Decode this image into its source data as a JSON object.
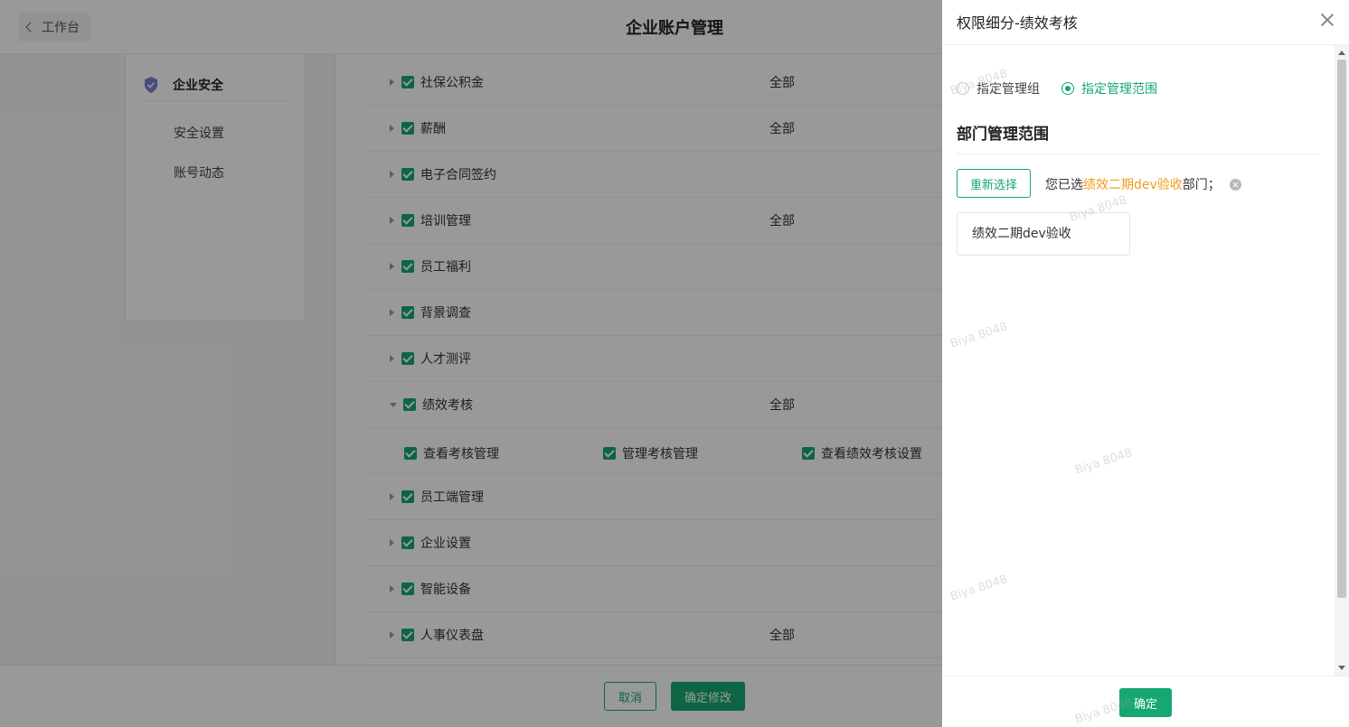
{
  "header": {
    "back_label": "工作台",
    "title": "企业账户管理"
  },
  "sidebar": {
    "section_label": "企业安全",
    "items": [
      {
        "label": "安全设置"
      },
      {
        "label": "账号动态"
      }
    ]
  },
  "permissions": {
    "rows": [
      {
        "label": "社保公积金",
        "scope": "全部"
      },
      {
        "label": "薪酬",
        "scope": "全部"
      },
      {
        "label": "电子合同签约",
        "scope": ""
      },
      {
        "label": "培训管理",
        "scope": "全部"
      },
      {
        "label": "员工福利",
        "scope": ""
      },
      {
        "label": "背景调查",
        "scope": ""
      },
      {
        "label": "人才测评",
        "scope": ""
      },
      {
        "label": "绩效考核",
        "scope": "全部",
        "expanded": true
      },
      {
        "label": "员工端管理",
        "scope": ""
      },
      {
        "label": "企业设置",
        "scope": ""
      },
      {
        "label": "智能设备",
        "scope": ""
      },
      {
        "label": "人事仪表盘",
        "scope": "全部"
      }
    ],
    "sub_items": [
      {
        "label": "查看考核管理"
      },
      {
        "label": "管理考核管理"
      },
      {
        "label": "查看绩效考核设置"
      }
    ]
  },
  "footer": {
    "cancel_label": "取消",
    "confirm_label": "确定修改"
  },
  "drawer": {
    "title": "权限细分-绩效考核",
    "radios": [
      {
        "label": "指定管理组",
        "checked": false
      },
      {
        "label": "指定管理范围",
        "checked": true
      }
    ],
    "section_title": "部门管理范围",
    "reselect_label": "重新选择",
    "selected_prefix": "您已选",
    "selected_dept": "绩效二期dev验收",
    "selected_suffix": "部门；",
    "dept_tag": "绩效二期dev验收",
    "ok_label": "确定"
  },
  "watermark": "Biya 8048",
  "colors": {
    "primary": "#16a870",
    "highlight": "#f29b1d",
    "shield": "#7b7fd6"
  }
}
